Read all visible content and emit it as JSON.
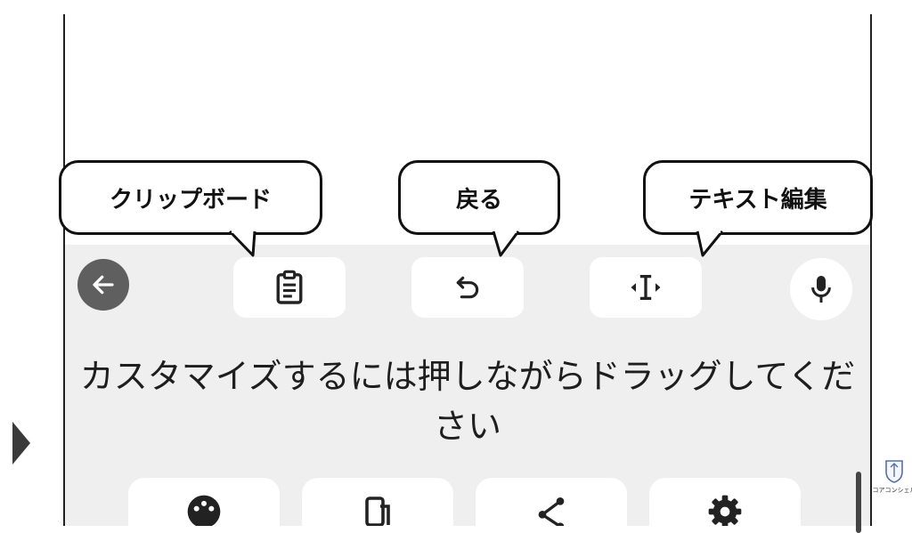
{
  "toolbar": {
    "back_icon": "arrow-left-icon",
    "clipboard_icon": "clipboard-icon",
    "undo_icon": "undo-icon",
    "text_edit_icon": "text-cursor-icon",
    "mic_icon": "microphone-icon"
  },
  "callouts": {
    "clipboard": "クリップボード",
    "undo": "戻る",
    "text_edit": "テキスト編集"
  },
  "hint_text": "カスタマイズするには押しながらドラッグしてください",
  "grid_icons": [
    "palette-icon",
    "phone-resize-icon",
    "share-icon",
    "gear-icon"
  ],
  "logo_text": "コアコンシェル",
  "colors": {
    "keyboard_bg": "#efefef",
    "button_bg": "#ffffff",
    "back_button": "#5f5f5f",
    "icon": "#222222",
    "callout_border": "#111111"
  }
}
